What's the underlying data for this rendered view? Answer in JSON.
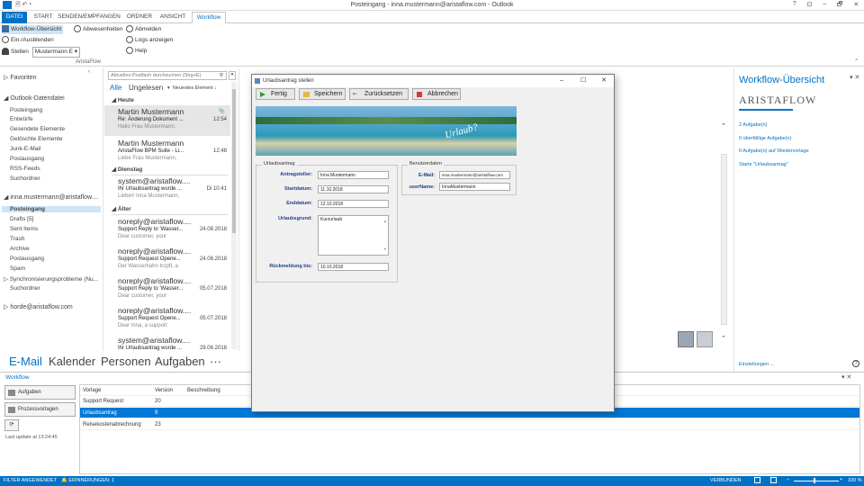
{
  "window": {
    "title": "Posteingang - inna.mustermann@aristaflow.com - Outlook",
    "controls": [
      "?",
      "⊡",
      "–",
      "🗗",
      "✕"
    ]
  },
  "tabs": [
    {
      "label": "DATEI"
    },
    {
      "label": "START"
    },
    {
      "label": "SENDEN/EMPFANGEN"
    },
    {
      "label": "ORDNER"
    },
    {
      "label": "ANSICHT"
    },
    {
      "label": "Workflow"
    }
  ],
  "ribbon": {
    "overview": "Workflow-Übersicht",
    "show_hide": "Ein-/Ausblenden",
    "stellen": "Stellen",
    "stellen_value": "Mustermann E",
    "absences": "Abwesenheiten",
    "logout": "Abmelden",
    "logs": "Logs anzeigen",
    "help": "Help",
    "group": "AristaFlow"
  },
  "leftnav": {
    "favorites": "Favoriten",
    "datafile": "Outlook-Datendatei",
    "items1": [
      "Posteingang",
      "Entwürfe",
      "Gesendete Elemente",
      "Gelöschte Elemente",
      "Junk-E-Mail",
      "Postausgang",
      "RSS-Feeds",
      "Suchordner"
    ],
    "account": "inna.mustermann@aristaflow....",
    "items2": [
      "Posteingang",
      "Drafts [5]",
      "Sent Items",
      "Trash",
      "Archive",
      "Postausgang",
      "Spam",
      "Synchronisierungsprobleme (Nu...",
      "Suchordner"
    ],
    "account2": "horde@aristaflow.com"
  },
  "msglist": {
    "search_placeholder": "Aktuelles Postfach durchsuchen (Strg+E)",
    "filter_all": "Alle",
    "filter_unread": "Ungelesen",
    "sort": "Neuestes Element ↓",
    "groups": [
      "Heute",
      "Dienstag",
      "Älter"
    ],
    "messages": [
      {
        "from": "Martin Mustermann",
        "subject": "Re: Änderung Dokument ...",
        "preview": "Hallo Frau Mustermann,",
        "date": "12:54"
      },
      {
        "from": "Martin Mustermann",
        "subject": "AristaFlow BPM Suite - Li...",
        "preview": "Liebe Frau Mustermann,",
        "date": "12:48"
      },
      {
        "from": "system@aristaflow....",
        "subject": "Ihr Urlaubsantrag wurde ...",
        "preview": "Liebe/r Inna Mustermann,",
        "date": "Di 10:41"
      },
      {
        "from": "noreply@aristaflow....",
        "subject": "Support Reply to 'Wasser...",
        "preview": "Dear customer,  your",
        "date": "24.08.2018"
      },
      {
        "from": "noreply@aristaflow....",
        "subject": "Support Request Opene...",
        "preview": "Der Wasserhahn tropft,  a",
        "date": "24.08.2018"
      },
      {
        "from": "noreply@aristaflow....",
        "subject": "Support Reply to 'Wasser...",
        "preview": "Dear customer,  your",
        "date": "05.07.2018"
      },
      {
        "from": "noreply@aristaflow....",
        "subject": "Support Request Opene...",
        "preview": "Dear Inna,  a support",
        "date": "05.07.2018"
      },
      {
        "from": "system@aristaflow....",
        "subject": "Ihr Urlaubsantrag wurde ...",
        "preview": "",
        "date": "29.06.2018"
      }
    ]
  },
  "navbar": [
    "E-Mail",
    "Kalender",
    "Personen",
    "Aufgaben",
    "···"
  ],
  "rightpane": {
    "title": "Workflow-Übersicht",
    "logo": "ARISTAFLOW",
    "links": [
      "2 Aufgabe(n)",
      "0 überfällige Aufgabe(n)",
      "0 Aufgabe(n) auf Wiedervorlage",
      "Starte \"Urlaubsantrag\""
    ],
    "settings": "Einstellungen ..."
  },
  "bottom": {
    "title": "Workflow",
    "tasks": "Aufgaben",
    "templates": "Prozessvorlagen",
    "update": "Last update at 13:24:45",
    "cols": [
      "Vorlage",
      "Version",
      "Beschreibung"
    ],
    "rows": [
      {
        "name": "Support Request",
        "version": "20",
        "desc": ""
      },
      {
        "name": "Urlaubsantrag",
        "version": "9",
        "desc": ""
      },
      {
        "name": "Reisekostenabrechnung",
        "version": "23",
        "desc": ""
      }
    ]
  },
  "status": {
    "filter": "FILTER ANGEWENDET",
    "reminders": "ERINNERUNGEN: 1",
    "connected": "VERBUNDEN",
    "zoom": "100 %"
  },
  "dialog": {
    "title": "Urlaubsantrag stellen",
    "done": "Fertig",
    "save": "Speichern",
    "reset": "Zurücksetzen",
    "cancel": "Abbrechen",
    "banner_text": "Urlaub?",
    "group1": "Urlaubsantrag",
    "l_applicant": "Antragsteller:",
    "v_applicant": "Inna Mustermann",
    "l_start": "Startdatum:",
    "v_start": "11.10.2018",
    "l_end": "Enddatum:",
    "v_end": "12.10.2018",
    "l_reason": "Urlaubsgrund:",
    "v_reason": "Kurzurlaub",
    "l_reply": "Rückmeldung bis:",
    "v_reply": "10.10.2018",
    "group2": "Benutzerdaten",
    "l_email": "E-Mail:",
    "v_email": "inna.mustermann@aristaflow.com",
    "l_user": "userName:",
    "v_user": "InnaMustermann"
  }
}
